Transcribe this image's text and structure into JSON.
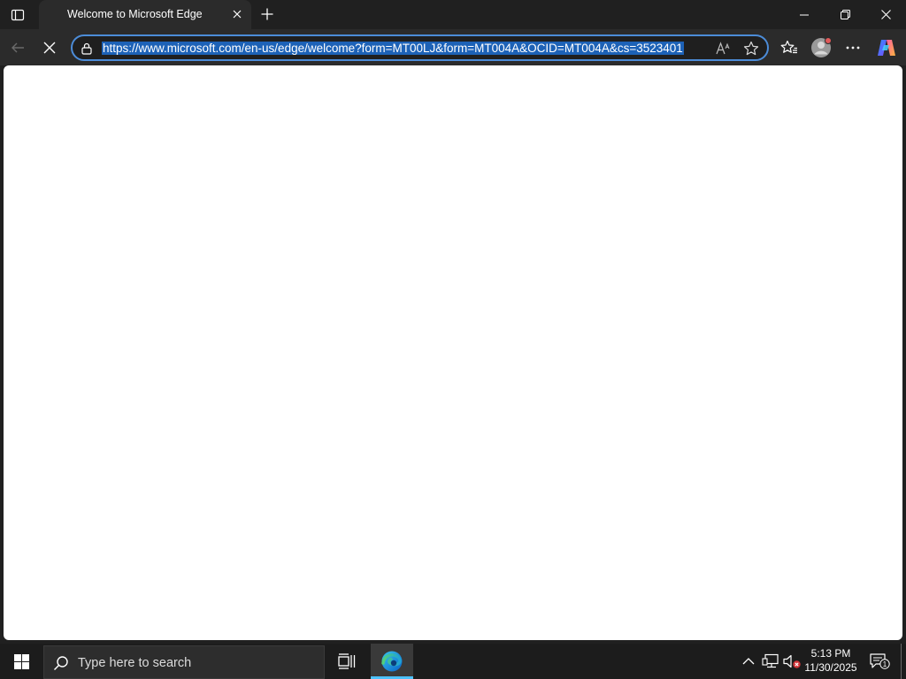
{
  "browser": {
    "tab": {
      "title": "Welcome to Microsoft Edge"
    },
    "address_bar": {
      "url": "https://www.microsoft.com/en-us/edge/welcome?form=MT00LJ&form=MT004A&OCID=MT004A&cs=3523401"
    },
    "icons": {
      "tab_actions": "tab-actions-icon",
      "close_tab": "close-icon",
      "new_tab": "plus-icon",
      "minimize": "minimize-icon",
      "restore": "restore-icon",
      "close_window": "close-icon",
      "back": "back-arrow-icon",
      "stop": "stop-loading-icon",
      "lock": "site-info-icon",
      "read_aloud": "read-aloud-icon",
      "favorite": "star-icon",
      "favorites": "favorites-icon",
      "profile": "profile-icon",
      "more": "more-icon",
      "copilot": "copilot-icon"
    }
  },
  "taskbar": {
    "search_placeholder": "Type here to search",
    "clock": {
      "time": "5:13 PM",
      "date": "11/30/2025"
    },
    "notification_count": "1"
  },
  "colors": {
    "accent": "#4c8cd8",
    "selection": "#1d62b7",
    "taskbar_active": "#4cc2ff"
  }
}
